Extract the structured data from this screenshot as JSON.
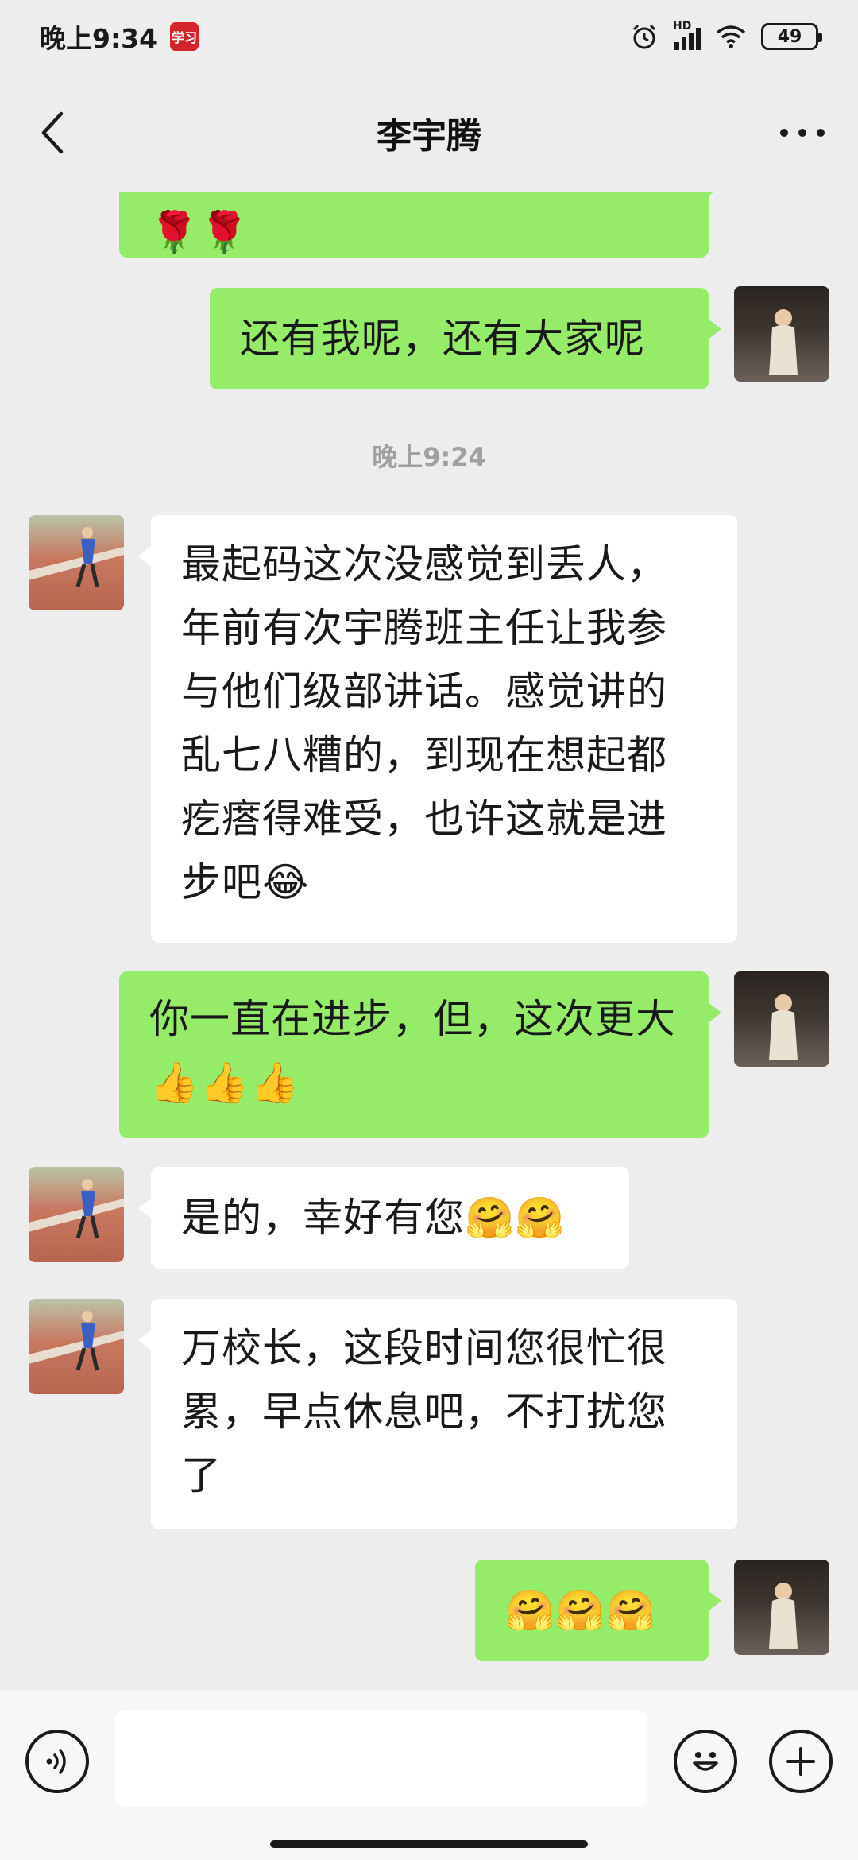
{
  "status_bar": {
    "time": "晚上9:34",
    "app_badge": "学习",
    "network": "HD",
    "battery": "49"
  },
  "header": {
    "title": "李宇腾"
  },
  "messages": {
    "m0": {
      "text": "🌹🌹"
    },
    "m1": {
      "text": "还有我呢，还有大家呢"
    },
    "timestamp": "晚上9:24",
    "m2": {
      "text": "最起码这次没感觉到丢人，年前有次宇腾班主任让我参与他们级部讲话。感觉讲的乱七八糟的，到现在想起都疙瘩得难受，也许这就是进步吧😂"
    },
    "m3": {
      "text": "你一直在进步，但，这次更大👍👍👍"
    },
    "m4": {
      "text": "是的，幸好有您🤗🤗"
    },
    "m5": {
      "text": "万校长，这段时间您很忙很累，早点休息吧，不打扰您了"
    },
    "m6": {
      "text": "🤗🤗🤗"
    }
  },
  "input": {
    "value": ""
  },
  "icons": {
    "back": "chevron-left-icon",
    "more": "more-dots-icon",
    "voice": "voice-icon",
    "emoji": "emoji-icon",
    "add": "plus-icon"
  }
}
